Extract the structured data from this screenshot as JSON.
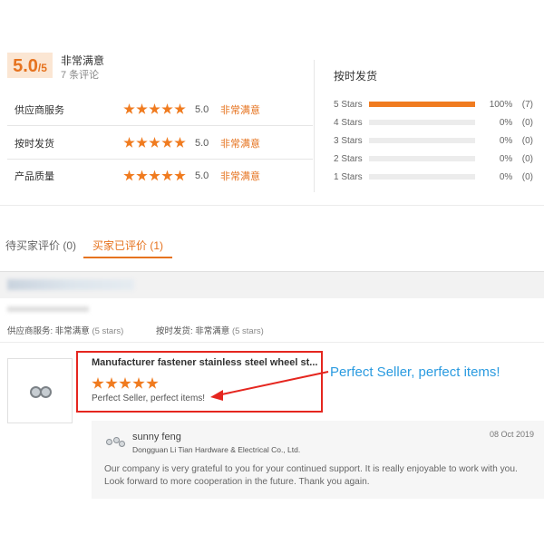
{
  "overall": {
    "score": "5.0",
    "scale": "/5",
    "label": "非常满意",
    "count": "7 条评论"
  },
  "ratings": [
    {
      "label": "供应商服务",
      "stars": 5,
      "score": "5.0",
      "text": "非常满意"
    },
    {
      "label": "按时发货",
      "stars": 5,
      "score": "5.0",
      "text": "非常满意"
    },
    {
      "label": "产品质量",
      "stars": 5,
      "score": "5.0",
      "text": "非常满意"
    }
  ],
  "distribution": {
    "title": "按时发货",
    "rows": [
      {
        "label": "5 Stars",
        "fill": 1.0,
        "pct": "100%",
        "count": "(7)"
      },
      {
        "label": "4 Stars",
        "fill": 0,
        "pct": "0%",
        "count": "(0)"
      },
      {
        "label": "3 Stars",
        "fill": 0,
        "pct": "0%",
        "count": "(0)"
      },
      {
        "label": "2 Stars",
        "fill": 0,
        "pct": "0%",
        "count": "(0)"
      },
      {
        "label": "1 Stars",
        "fill": 0,
        "pct": "0%",
        "count": "(0)"
      }
    ]
  },
  "tabs": {
    "pending": "待买家评价 (0)",
    "reviewed": "买家已评价 (1)"
  },
  "review": {
    "summary_service_label": "供应商服务:",
    "summary_service_value": "非常满意",
    "summary_service_stars": "(5 stars)",
    "summary_ship_label": "按时发货:",
    "summary_ship_value": "非常满意",
    "summary_ship_stars": "(5 stars)",
    "product_title": "Manufacturer fastener stainless steel wheel st...",
    "product_stars": 5,
    "comment": "Perfect Seller, perfect items!",
    "callout": "Perfect Seller, perfect items!"
  },
  "reply": {
    "name": "sunny feng",
    "company": "Dongguan Li Tian Hardware & Electrical Co., Ltd.",
    "date": "08 Oct 2019",
    "text": "Our company is very grateful to you for your continued support. It is really enjoyable to work with you. Look forward to more cooperation in the future. Thank you again."
  },
  "colors": {
    "accent": "#e6731f",
    "star": "#f07b1f",
    "highlight_border": "#e5261f",
    "callout": "#2b9be0"
  },
  "icons": [
    "star-icon",
    "product-thumbnail",
    "supplier-logo-icon",
    "arrow-annotation"
  ]
}
